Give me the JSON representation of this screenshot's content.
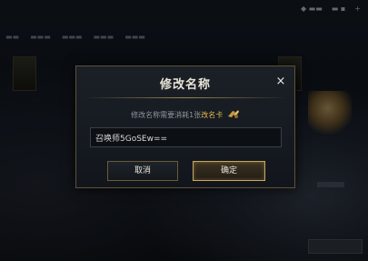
{
  "dialog": {
    "title": "修改名称",
    "close_glyph": "×",
    "notice_prefix": "修改名称需要消耗1张",
    "notice_highlight": "改名卡",
    "input_value": "召唤师5GoSEw==",
    "cancel_label": "取消",
    "confirm_label": "确定"
  },
  "colors": {
    "accent_gold": "#e2b94f",
    "border_gold": "#c9a85e",
    "panel_bg": "#1b2027"
  },
  "icons": [
    "close-icon",
    "rename-card-icon"
  ]
}
